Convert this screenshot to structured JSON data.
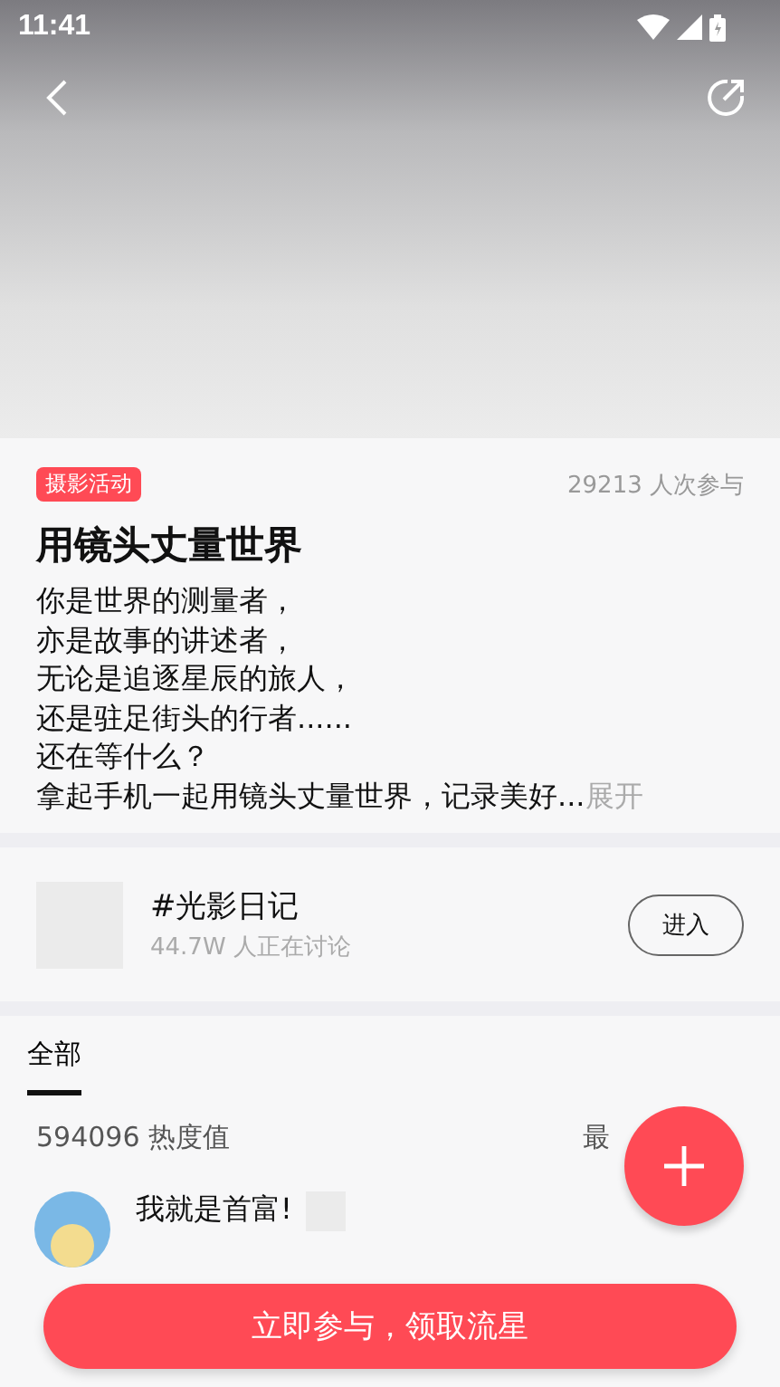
{
  "status_bar": {
    "time": "11:41"
  },
  "activity": {
    "tag": "摄影活动",
    "participants": "29213 人次参与",
    "title": "用镜头丈量世界",
    "description_lines": [
      "你是世界的测量者，",
      "亦是故事的讲述者，",
      "无论是追逐星辰的旅人，",
      "还是驻足街头的行者......",
      "还在等什么？",
      "拿起手机一起用镜头丈量世界，记录美好..."
    ],
    "expand": "展开"
  },
  "topic": {
    "name": "#光影日记",
    "discussing": "44.7W 人正在讨论",
    "button": "进入"
  },
  "tabs": [
    {
      "label": "全部",
      "selected": true
    }
  ],
  "heat": {
    "value": "594096 热度值",
    "sort": "最"
  },
  "posts": [
    {
      "author": "我就是首富!"
    }
  ],
  "cta_button": "立即参与，领取流星"
}
